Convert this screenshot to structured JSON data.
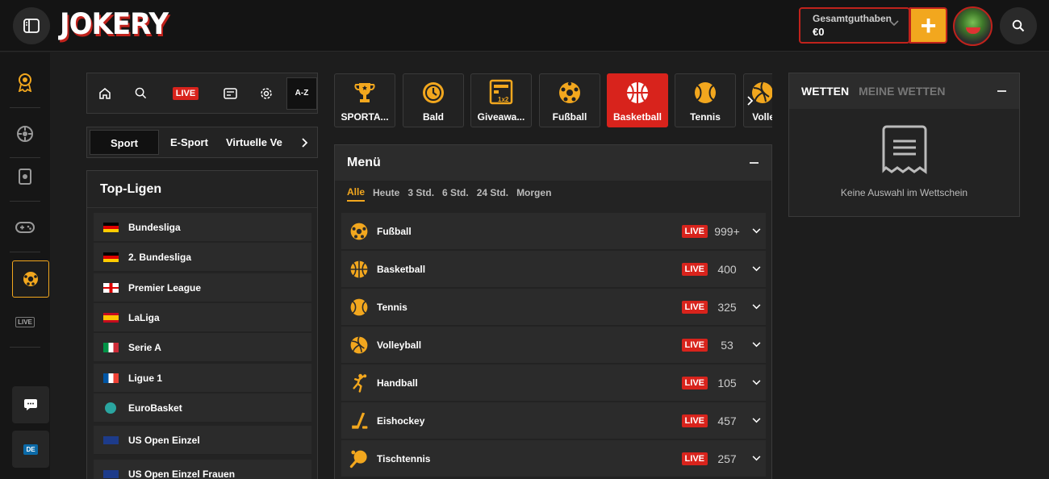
{
  "header": {
    "logo": "JOKERY",
    "balance_label": "Gesamtguthaben",
    "balance_amount": "€0",
    "deposit_label": "+"
  },
  "quicknav": {
    "live": "LIVE",
    "az": "A-Z"
  },
  "sport_tabs": [
    "Sport",
    "E-Sport",
    "Virtuelle Ve"
  ],
  "top_leagues": {
    "title": "Top-Ligen",
    "items": [
      "Bundesliga",
      "2. Bundesliga",
      "Premier League",
      "LaLiga",
      "Serie A",
      "Ligue 1",
      "EuroBasket",
      "US Open Einzel",
      "US Open Einzel Frauen"
    ]
  },
  "categories": [
    "SPORTA...",
    "Bald",
    "Giveawa...",
    "Fußball",
    "Basketball",
    "Tennis",
    "Volle"
  ],
  "menu": {
    "title": "Menü",
    "time_tabs": [
      "Alle",
      "Heute",
      "3 Std.",
      "6 Std.",
      "24 Std.",
      "Morgen"
    ],
    "sports": [
      {
        "name": "Fußball",
        "live": "LIVE",
        "count": "999+"
      },
      {
        "name": "Basketball",
        "live": "LIVE",
        "count": "400"
      },
      {
        "name": "Tennis",
        "live": "LIVE",
        "count": "325"
      },
      {
        "name": "Volleyball",
        "live": "LIVE",
        "count": "53"
      },
      {
        "name": "Handball",
        "live": "LIVE",
        "count": "105"
      },
      {
        "name": "Eishockey",
        "live": "LIVE",
        "count": "457"
      },
      {
        "name": "Tischtennis",
        "live": "LIVE",
        "count": "257"
      }
    ]
  },
  "betslip": {
    "tab_active": "WETTEN",
    "tab_other": "MEINE WETTEN",
    "empty": "Keine Auswahl im Wettschein"
  },
  "leftnav": {
    "live": "LIVE",
    "lang": "DE"
  },
  "colors": {
    "accent": "#f2a71e",
    "live": "#d8231c"
  }
}
